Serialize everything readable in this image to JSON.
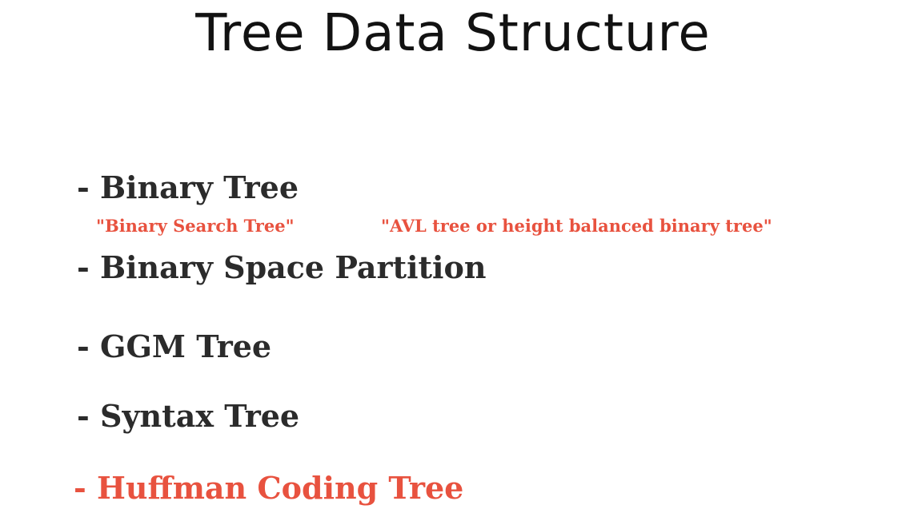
{
  "title": "Tree Data Structure",
  "items": [
    {
      "label": "- Binary Tree"
    },
    {
      "label": "- Binary Space Partition"
    },
    {
      "label": "- GGM Tree"
    },
    {
      "label": "- Syntax Tree"
    },
    {
      "label": "- Huffman Coding Tree"
    }
  ],
  "sub_items": [
    {
      "label": "\"Binary  Search Tree\""
    },
    {
      "label": "\"AVL tree or height balanced binary tree\""
    }
  ],
  "colors": {
    "title": "#121212",
    "text": "#2b2b2b",
    "accent": "#e8523f",
    "background": "#ffffff"
  }
}
